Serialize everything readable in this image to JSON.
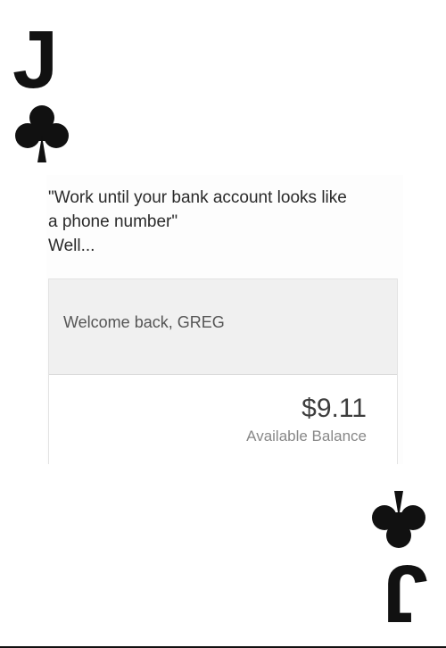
{
  "card": {
    "rank": "J",
    "suit_icon": "club-icon",
    "suit_color": "#111111"
  },
  "meme": {
    "quote_line_1": "\"Work until your bank account looks like",
    "quote_line_2": "a phone number\"",
    "quote_line_3": "Well..."
  },
  "bank": {
    "welcome_text": "Welcome back, GREG",
    "balance_amount": "$9.11",
    "balance_label": "Available Balance"
  }
}
